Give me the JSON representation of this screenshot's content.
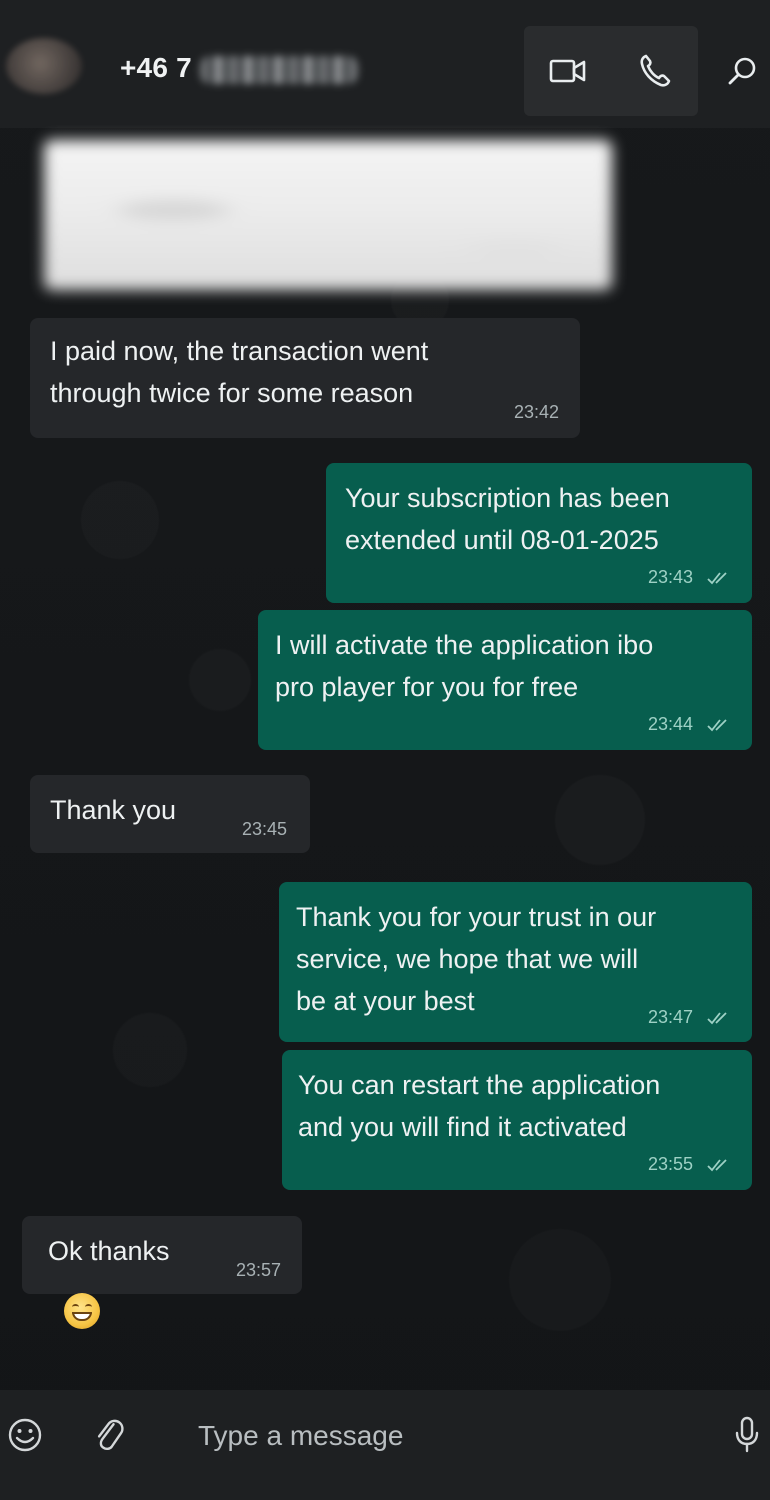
{
  "header": {
    "contact_name": "+46 7",
    "icons": [
      "video-call-icon",
      "voice-call-icon",
      "search-icon"
    ]
  },
  "messages": [
    {
      "direction": "in",
      "text": "I paid now, the transaction went\nthrough twice for some reason",
      "time": "23:42"
    },
    {
      "direction": "out",
      "text": "Your subscription has been\nextended until 08-01-2025",
      "time": "23:43",
      "status": "read"
    },
    {
      "direction": "out",
      "text": "I will activate the application ibo\npro player for you for free",
      "time": "23:44",
      "status": "read"
    },
    {
      "direction": "in",
      "text": "Thank you",
      "time": "23:45"
    },
    {
      "direction": "out",
      "text": "Thank you for your trust in our\nservice, we hope that we will\nbe at your best",
      "time": "23:47",
      "status": "read"
    },
    {
      "direction": "out",
      "text": "You can restart the application\nand you will find it activated",
      "time": "23:55",
      "status": "read"
    },
    {
      "direction": "in",
      "text": "Ok thanks",
      "time": "23:57",
      "emoji": "grinning-face"
    }
  ],
  "composer": {
    "placeholder": "Type a message",
    "icons": [
      "emoji-icon",
      "attach-icon",
      "microphone-icon"
    ]
  },
  "colors": {
    "background": "#141618",
    "header": "#1e2022",
    "incoming_bubble": "#25272a",
    "outgoing_bubble": "#075e4e",
    "text": "#eef1f2"
  }
}
